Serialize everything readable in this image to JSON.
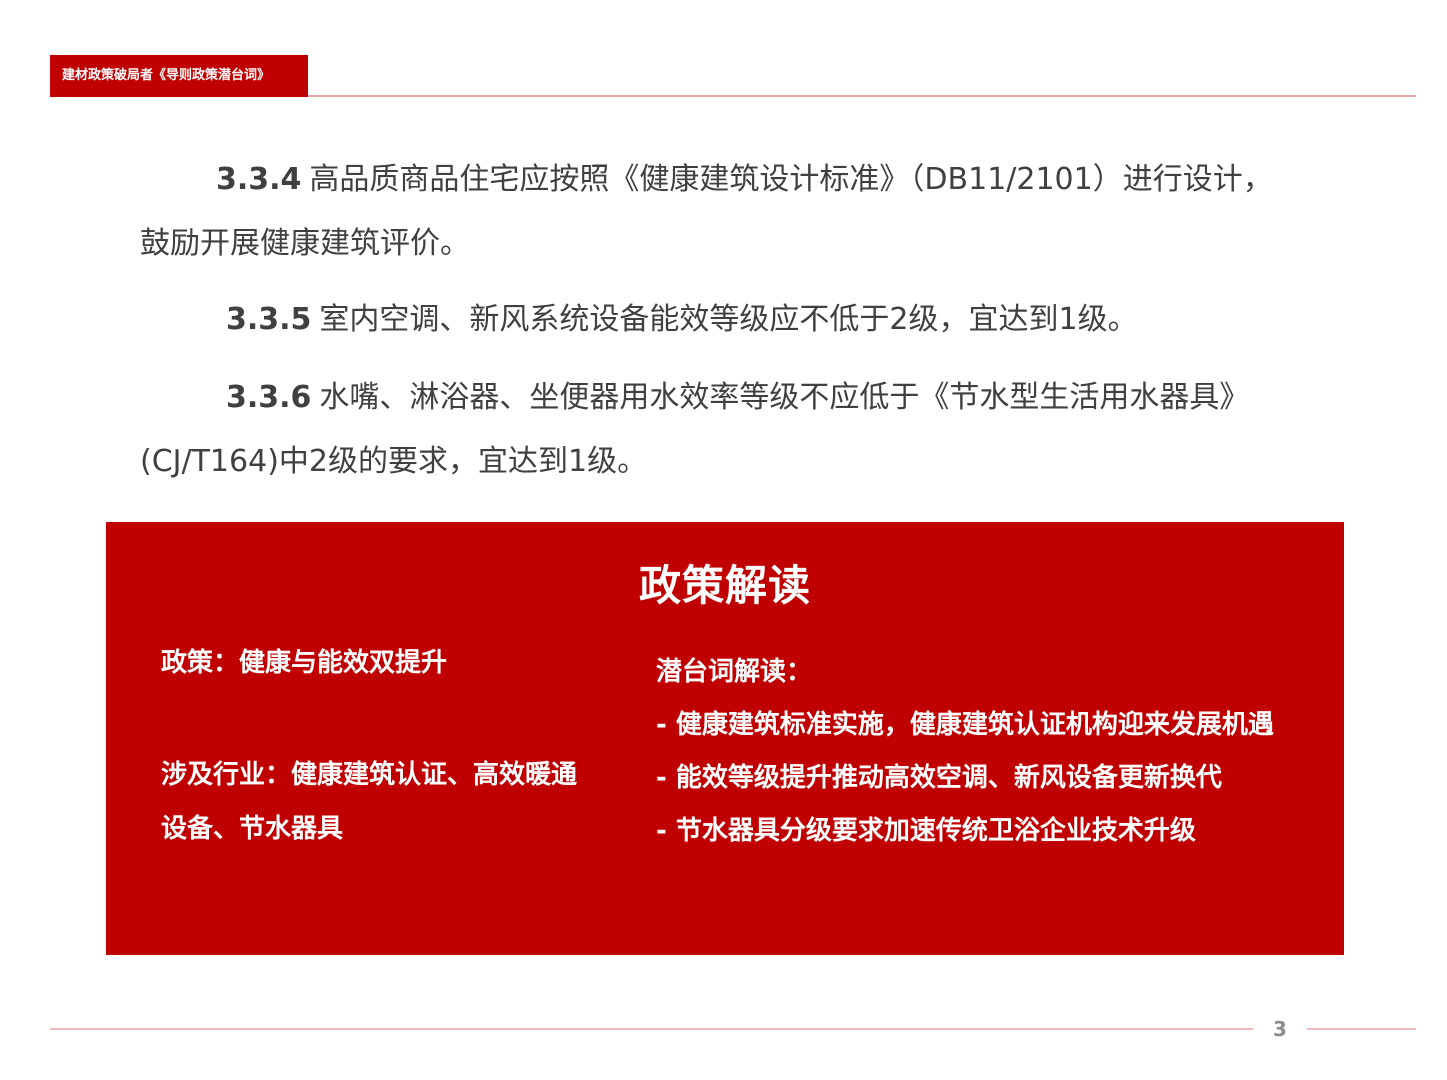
{
  "header": {
    "tag": "建材政策破局者《导则政策潜台词》"
  },
  "clauses": [
    {
      "num": "3.3.4",
      "text": "高品质商品住宅应按照《健康建筑设计标准》（DB11/2101）进行设计，鼓励开展健康建筑评价。"
    },
    {
      "num": "3.3.5",
      "text": "室内空调、新风系统设备能效等级应不低于2级，宜达到1级。"
    },
    {
      "num": "3.3.6",
      "text": "水嘴、淋浴器、坐便器用水效率等级不应低于《节水型生活用水器具》(CJ/T164)中2级的要求，宜达到1级。"
    }
  ],
  "panel": {
    "title": "政策解读",
    "policy": "政策：健康与能效双提升",
    "industries": "涉及行业：健康建筑认证、高效暖通设备、节水器具",
    "subtext_title": "潜台词解读：",
    "points": [
      "- 健康建筑标准实施，健康建筑认证机构迎来发展机遇",
      "- 能效等级提升推动高效空调、新风设备更新换代",
      "- 节水器具分级要求加速传统卫浴企业技术升级"
    ]
  },
  "footer": {
    "page_number": "3"
  },
  "colors": {
    "accent": "#c00000",
    "text": "#404040",
    "line": "#e8a6a6"
  }
}
